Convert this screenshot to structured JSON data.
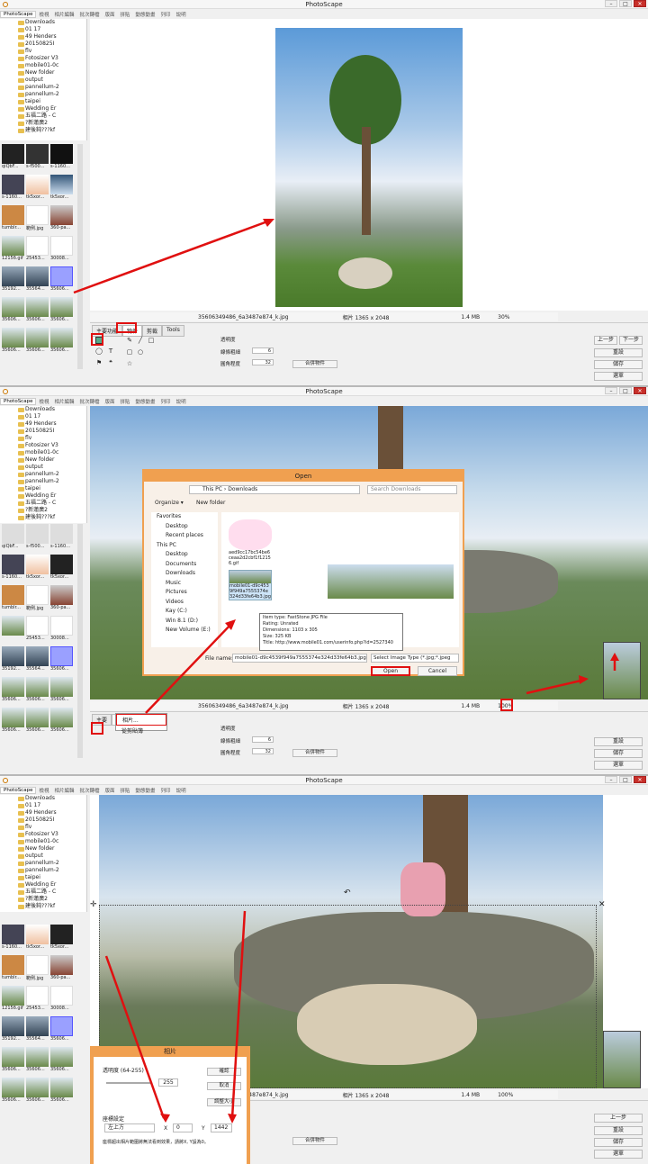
{
  "app": {
    "title": "PhotoScape"
  },
  "tabs": [
    "PhotoScape",
    "檢視",
    "相片編輯",
    "批次轉檔",
    "版面",
    "拼貼",
    "動態動畫",
    "列印",
    "說明"
  ],
  "folder_tree": [
    "Downloads",
    "01 17",
    "49 Henders",
    "20150825I",
    "flv",
    "Fotosizer V3",
    "mobile01-0c",
    "New folder",
    "output",
    "pannellum-2",
    "pannellum-2",
    "taipei",
    "Wedding Er",
    "五福二路 - C",
    "?新蓮廣2",
    "建後鈍???kf"
  ],
  "folder_tree_short": [
    "Downloads",
    "01 17",
    "49 Henders",
    "20150825I",
    "flv",
    "Fotosizer V3",
    "mobile01-0c",
    "New folder",
    "output",
    "pannellum-2",
    "pannellum-2",
    "taipei",
    "Wedding Er",
    "五福二路 - C",
    "?新蓮廣2",
    "建後鈍???kf"
  ],
  "thumbs_p1": [
    "qiQbF...",
    "s-f500...",
    "s-1160...",
    "s-1160...",
    "tk5xor...",
    "tk5xor...",
    "tumblr...",
    "範例.jpg",
    "360-pa...",
    "1215б.gif",
    "25453...",
    "30008...",
    "35192...",
    "35564...",
    "35606...",
    "35606...",
    "35606...",
    "35606...",
    "35606...",
    "35606...",
    "35606..."
  ],
  "thumbs_p2": [
    "qiQbF...",
    "s-f500...",
    "s-1160...",
    "s-1160...",
    "tk5xor...",
    "tk5xor...",
    "tumblr...",
    "範例.jpg",
    "360-pa...",
    "",
    "25453...",
    "30008...",
    "35192...",
    "35564...",
    "35606...",
    "35606...",
    "35606...",
    "35606...",
    "35606...",
    "35606...",
    "35606...",
    "35606...",
    "35606...",
    "35606..."
  ],
  "thumbs_p3": [
    "s-1160...",
    "tk5xor...",
    "tk5xor...",
    "tumblr...",
    "範例.jpg",
    "360-pa...",
    "1215б.gif",
    "25453...",
    "30008...",
    "35192...",
    "35564...",
    "35606...",
    "35606...",
    "35606...",
    "35606...",
    "35606...",
    "35606...",
    "35606...",
    "35606...",
    "35606..."
  ],
  "status": {
    "filename": "35606349486_6a3487e874_k.jpg",
    "dims": "相片 1365 x 2048",
    "size": "1.4 MB",
    "zoom1": "30%",
    "zoom2": "100%"
  },
  "editor_tabs": {
    "main": "主要功能",
    "object": "物件",
    "crop": "剪裁",
    "tools": "Tools"
  },
  "editor_tabs_p2": {
    "main": "主要",
    "object": "物件"
  },
  "editor_fields": {
    "opacity": "透明度",
    "outline": "線條粗細",
    "outline_val": "6",
    "round": "圓角程度",
    "round_val": "32",
    "merge": "合併物件"
  },
  "right_buttons": {
    "undo": "上一步",
    "redo": "下一步",
    "reset": "重設",
    "save": "儲存",
    "menu": "選單"
  },
  "context_menu": [
    "相片...",
    "從剪貼簿"
  ],
  "open_dialog": {
    "title": "Open",
    "path": [
      "This PC",
      "Downloads"
    ],
    "search": "Search Downloads",
    "organize": "Organize ▾",
    "new_folder": "New folder",
    "nav": [
      "Favorites",
      "Desktop",
      "Recent places",
      "This PC",
      "Desktop",
      "Documents",
      "Downloads",
      "Music",
      "Pictures",
      "Videos",
      "Kay (C:)",
      "Win 8.1 (D:)",
      "New Volume (E:)"
    ],
    "file1": "aed9cc17bc54be6ceaa2d2cbf1f12156.gif",
    "file2": "mobile01-d9c4539f949a7555374e324d33fe64b3.jpg",
    "tooltip": [
      "Item type: FastStone JPG File",
      "Rating: Unrated",
      "Dimensions: 1103 x 305",
      "Size: 325 KB",
      "Title: http://www.mobile01.com/userinfo.php?id=2527340"
    ],
    "file_name_label": "File name:",
    "file_name": "mobile01-d9c4539f949a7555374e324d33fe64b3.jpg",
    "type": "Select Image Type (*.jpg;*.jpeg",
    "open": "Open",
    "cancel": "Cancel"
  },
  "photo_dialog": {
    "title": "相片",
    "opacity_label": "透明度 (64-255)",
    "opacity_val": "255",
    "ok": "確認",
    "cancel": "取消",
    "resize": "調整大小",
    "pos_label": "座標設定",
    "anchor": "左上方",
    "x_label": "X",
    "x_val": "0",
    "y_label": "Y",
    "y_val": "1442",
    "note": "座標超出相片範圍將無法看到效果，請將X, Y設為0。"
  },
  "colors": {
    "accent": "#e01010",
    "dialog_border": "#f0a050",
    "titlebar_close": "#c8302a"
  }
}
